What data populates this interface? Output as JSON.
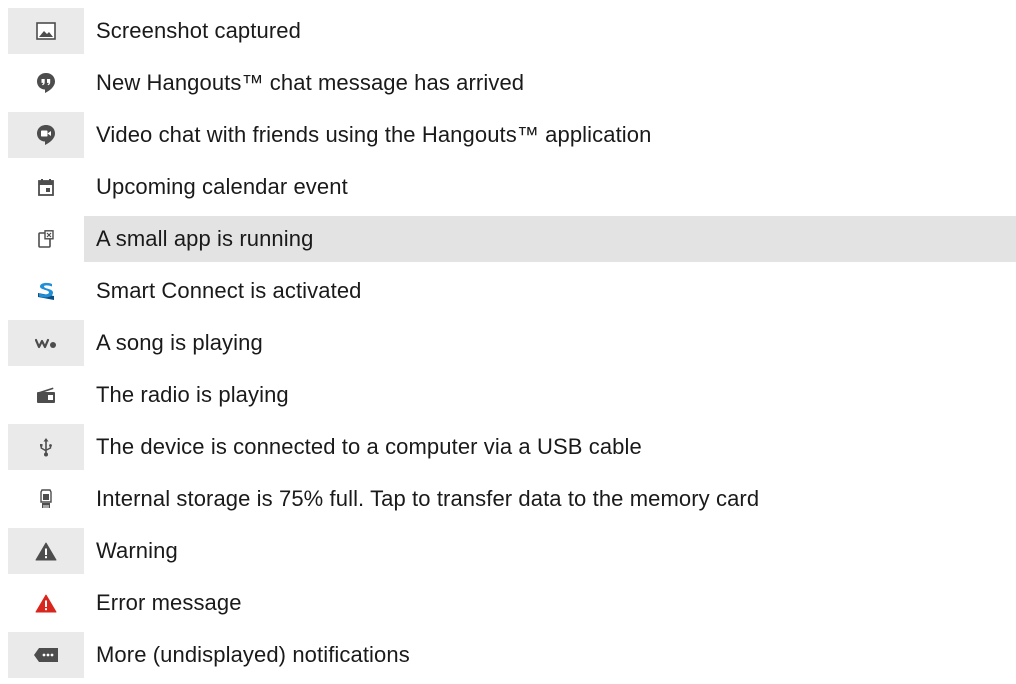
{
  "colors": {
    "row_shade": "#eaeaea",
    "label_shade": "#e3e3e3",
    "icon_gray": "#4d4d4d",
    "smart_connect_blue": "#1f8fd6",
    "error_red": "#d8261e"
  },
  "items": [
    {
      "icon": "screenshot-icon",
      "label": "Screenshot captured"
    },
    {
      "icon": "hangouts-chat-icon",
      "label": "New Hangouts™ chat message has arrived"
    },
    {
      "icon": "hangouts-video-icon",
      "label": "Video chat with friends using the Hangouts™ application"
    },
    {
      "icon": "calendar-icon",
      "label": "Upcoming calendar event"
    },
    {
      "icon": "small-app-icon",
      "label": "A small app is running"
    },
    {
      "icon": "smart-connect-icon",
      "label": "Smart Connect is activated"
    },
    {
      "icon": "walkman-icon",
      "label": "A song is playing"
    },
    {
      "icon": "radio-icon",
      "label": "The radio is playing"
    },
    {
      "icon": "usb-icon",
      "label": "The device is connected to a computer via a USB cable"
    },
    {
      "icon": "storage-icon",
      "label": "Internal storage is 75% full. Tap to transfer data to the memory card"
    },
    {
      "icon": "warning-icon",
      "label": "Warning"
    },
    {
      "icon": "error-icon",
      "label": "Error message"
    },
    {
      "icon": "more-notifications-icon",
      "label": "More (undisplayed) notifications"
    }
  ]
}
